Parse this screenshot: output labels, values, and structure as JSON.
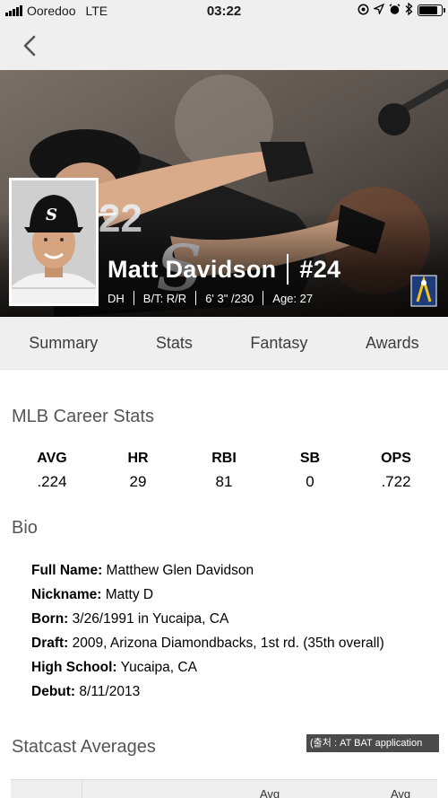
{
  "status_bar": {
    "carrier": "Ooredoo",
    "network": "LTE",
    "time": "03:22",
    "battery_level": 0.85
  },
  "nav": {
    "back_icon": "chevron-left-icon"
  },
  "player": {
    "name": "Matt Davidson",
    "number": "#24",
    "position": "DH",
    "bats_throws": "B/T: R/R",
    "height_weight": "6' 3\" /230",
    "age": "Age: 27",
    "team_logo": "white-sox-logo",
    "jersey_number_graphic": "22"
  },
  "tabs": [
    {
      "label": "Summary"
    },
    {
      "label": "Stats"
    },
    {
      "label": "Fantasy"
    },
    {
      "label": "Awards"
    }
  ],
  "career_stats": {
    "title": "MLB Career Stats",
    "stats": [
      {
        "label": "AVG",
        "value": ".224"
      },
      {
        "label": "HR",
        "value": "29"
      },
      {
        "label": "RBI",
        "value": "81"
      },
      {
        "label": "SB",
        "value": "0"
      },
      {
        "label": "OPS",
        "value": ".722"
      }
    ]
  },
  "bio": {
    "title": "Bio",
    "rows": [
      {
        "label": "Full Name:",
        "value": "Matthew Glen Davidson"
      },
      {
        "label": "Nickname:",
        "value": "Matty D"
      },
      {
        "label": "Born:",
        "value": "3/26/1991 in Yucaipa, CA"
      },
      {
        "label": "Draft:",
        "value": "2009, Arizona Diamondbacks, 1st rd. (35th overall)"
      },
      {
        "label": "High School:",
        "value": "Yucaipa, CA"
      },
      {
        "label": "Debut:",
        "value": "8/11/2013"
      }
    ]
  },
  "statcast": {
    "title": "Statcast Averages",
    "col1": "Avg",
    "col2": "Avg"
  },
  "watermark": "(출처 : AT BAT application"
}
